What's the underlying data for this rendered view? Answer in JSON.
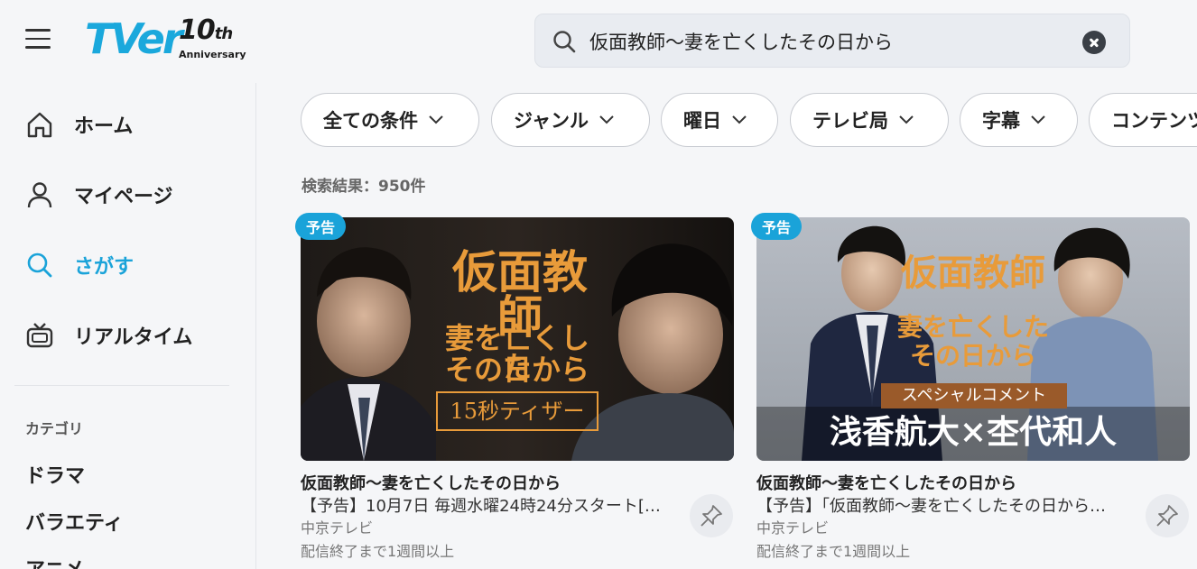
{
  "header": {
    "logo_text": "TVer",
    "logo_ten": "10",
    "logo_th": "th",
    "logo_anniversary": "Anniversary",
    "search_value": "仮面教師〜妻を亡くしたその日から"
  },
  "sidebar": {
    "items": [
      {
        "label": "ホーム",
        "icon": "home-icon"
      },
      {
        "label": "マイページ",
        "icon": "user-icon"
      },
      {
        "label": "さがす",
        "icon": "search-icon",
        "active": true
      },
      {
        "label": "リアルタイム",
        "icon": "tv-icon"
      }
    ],
    "category_heading": "カテゴリ",
    "categories": [
      "ドラマ",
      "バラエティ",
      "アニメ"
    ]
  },
  "filters": [
    {
      "label": "全ての条件"
    },
    {
      "label": "ジャンル"
    },
    {
      "label": "曜日"
    },
    {
      "label": "テレビ局"
    },
    {
      "label": "字幕"
    },
    {
      "label": "コンテンツ"
    }
  ],
  "results": {
    "count_text": "検索結果：950件",
    "cards": [
      {
        "badge": "予告",
        "title": "仮面教師〜妻を亡くしたその日から",
        "subtitle": "【予告】10月7日 毎週水曜24時24分スタート[…",
        "channel": "中京テレビ",
        "availability": "配信終了まで1週間以上",
        "thumb_title_1": "仮面教師",
        "thumb_title_2": "妻を亡くした",
        "thumb_title_3": "その日から",
        "thumb_caption": "15秒ティザー"
      },
      {
        "badge": "予告",
        "title": "仮面教師〜妻を亡くしたその日から",
        "subtitle": "【予告】「仮面教師〜妻を亡くしたその日から…",
        "channel": "中京テレビ",
        "availability": "配信終了まで1週間以上",
        "thumb_title_1": "仮面教師",
        "thumb_title_2": "妻を亡くした",
        "thumb_title_3": "その日から",
        "thumb_caption": "スペシャルコメント",
        "thumb_names": "浅香航大×杢代和人"
      }
    ]
  },
  "colors": {
    "brand": "#1aa3d9",
    "title_orange": "#e89b3a"
  }
}
